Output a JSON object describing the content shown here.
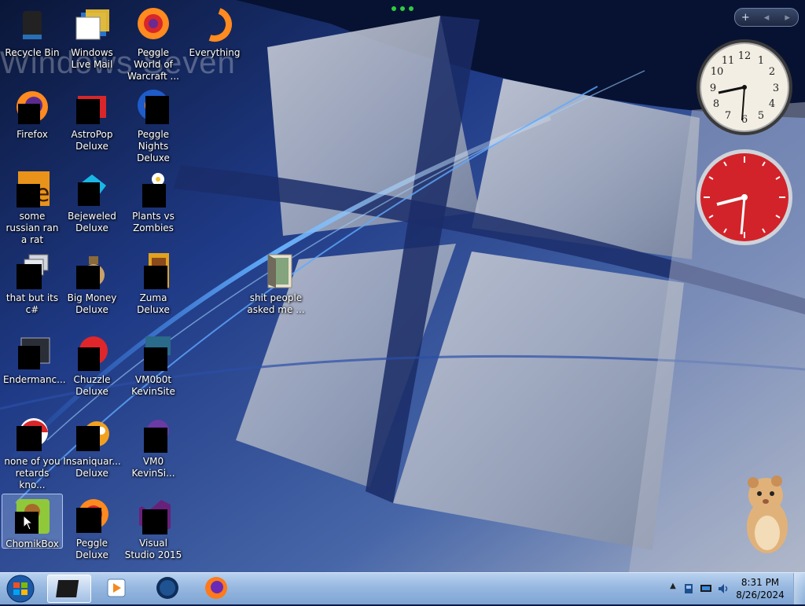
{
  "desktop": {
    "wallpaper_text": "Windows Seven",
    "icons": [
      {
        "label": "Recycle Bin"
      },
      {
        "label": "Windows Live Mail"
      },
      {
        "label": "Peggle World of Warcraft ..."
      },
      {
        "label": "Everything"
      },
      {
        "label": "Firefox"
      },
      {
        "label": "AstroPop Deluxe"
      },
      {
        "label": "Peggle Nights Deluxe"
      },
      {
        "label": "some russian ran a rat"
      },
      {
        "label": "Bejeweled Deluxe"
      },
      {
        "label": "Plants vs Zombies"
      },
      {
        "label": "that but its c#"
      },
      {
        "label": "Big Money Deluxe"
      },
      {
        "label": "Zuma Deluxe"
      },
      {
        "label": "shit people asked me ..."
      },
      {
        "label": "Endermanc..."
      },
      {
        "label": "Chuzzle Deluxe"
      },
      {
        "label": "VM0b0t KevinSite"
      },
      {
        "label": "none of you retards kno..."
      },
      {
        "label": "Insaniquar... Deluxe"
      },
      {
        "label": "VM0 KevinSi..."
      },
      {
        "label": "ChomikBox"
      },
      {
        "label": "Peggle Deluxe"
      },
      {
        "label": "Visual Studio 2015"
      }
    ],
    "selected_icon": "ChomikBox"
  },
  "gadgets": {
    "toolbar": {
      "add": "+",
      "prev": "◂",
      "next": "▸"
    },
    "analog_clock_1": {
      "time": "8:31"
    },
    "analog_clock_2": {
      "time": "8:31"
    },
    "clock_face_numbers": [
      "12",
      "1",
      "2",
      "3",
      "4",
      "5",
      "6",
      "7",
      "8",
      "9",
      "10",
      "11"
    ]
  },
  "taskbar": {
    "start_icon": "windows-orb-icon",
    "pinned": [
      {
        "name": "desktop-window-icon",
        "active": true
      },
      {
        "name": "media-player-icon",
        "active": false
      },
      {
        "name": "globe-icon",
        "active": false
      },
      {
        "name": "firefox-icon",
        "active": false
      }
    ],
    "tray": {
      "show_hidden": "▲",
      "time": "8:31 PM",
      "date": "8/26/2024"
    }
  },
  "colors": {
    "taskbar": "#97b8e0",
    "wallpaper_dark": "#0b1a45",
    "clock_red": "#d2232a"
  }
}
